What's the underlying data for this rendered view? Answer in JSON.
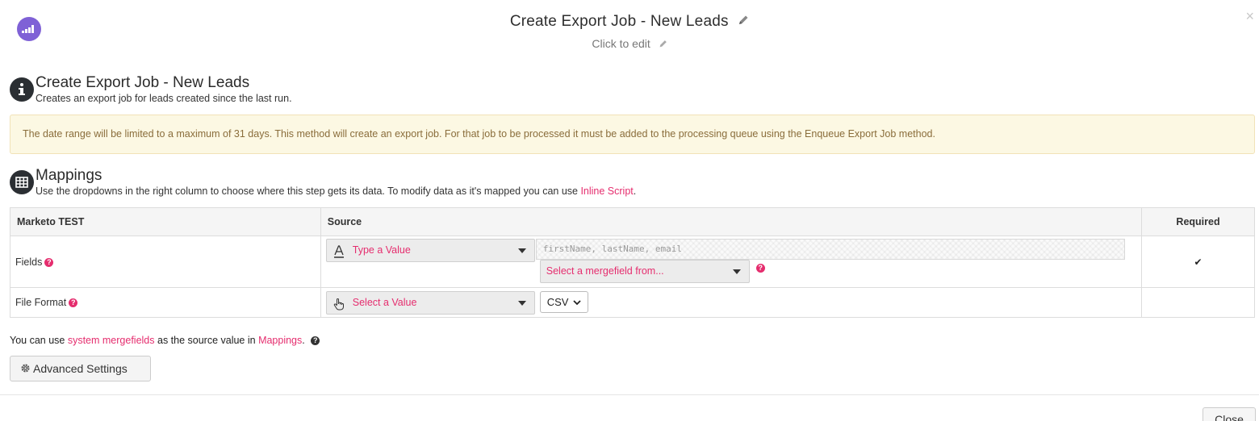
{
  "modal": {
    "title": "Create Export Job - New Leads",
    "subtitle": "Click to edit",
    "close_label": "Close",
    "close_x": "×"
  },
  "intro": {
    "title": "Create Export Job - New Leads",
    "description": "Creates an export job for leads created since the last run."
  },
  "alert": {
    "text": "The date range will be limited to a maximum of 31 days. This method will create an export job. For that job to be processed it must be added to the processing queue using the Enqueue Export Job method."
  },
  "mappings": {
    "title": "Mappings",
    "desc_prefix": "Use the dropdowns in the right column to choose where this step gets its data. To modify data as it's mapped you can use ",
    "desc_link": "Inline Script",
    "desc_suffix": ".",
    "columns": [
      "Marketo TEST",
      "Source",
      "Required"
    ],
    "rows": [
      {
        "label": "Fields",
        "source_type": "Type a Value",
        "value_placeholder": "firstName, lastName, email",
        "mergefield": "Select a mergefield from...",
        "required": "✔"
      },
      {
        "label": "File Format",
        "source_type": "Select a Value",
        "value": "CSV",
        "required": ""
      }
    ]
  },
  "footer": {
    "prefix": "You can use ",
    "link1": "system mergefields",
    "middle": " as the source value in ",
    "link2": "Mappings",
    "suffix": ".",
    "advanced_label": "Advanced Settings"
  },
  "colors": {
    "accent": "#e52d6e",
    "logo": "#7f61d6",
    "alert_bg": "#fcf8e3",
    "alert_text": "#8a6d3b"
  },
  "icons": [
    "marketo-logo-icon",
    "pencil-icon",
    "info-icon",
    "table-icon",
    "text-type-icon",
    "hand-pointer-icon",
    "help-icon",
    "checkmark-icon",
    "gear-icon",
    "chevron-down-icon",
    "close-icon"
  ]
}
